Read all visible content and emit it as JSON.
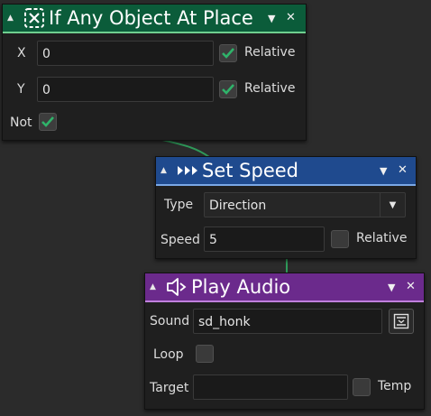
{
  "nodes": {
    "if_object": {
      "title": "If Any Object At Place",
      "x_label": "X",
      "x_value": "0",
      "x_relative_label": "Relative",
      "x_relative_checked": true,
      "y_label": "Y",
      "y_value": "0",
      "y_relative_label": "Relative",
      "y_relative_checked": true,
      "not_label": "Not",
      "not_checked": true,
      "header_color": "#0b5c3a"
    },
    "set_speed": {
      "title": "Set Speed",
      "type_label": "Type",
      "type_value": "Direction",
      "speed_label": "Speed",
      "speed_value": "5",
      "relative_label": "Relative",
      "relative_checked": false,
      "header_color": "#1f4a8e"
    },
    "play_audio": {
      "title": "Play Audio",
      "sound_label": "Sound",
      "sound_value": "sd_honk",
      "loop_label": "Loop",
      "loop_checked": false,
      "target_label": "Target",
      "target_value": "",
      "temp_label": "Temp",
      "temp_checked": false,
      "header_color": "#6b2a8c"
    }
  },
  "colors": {
    "canvas": "#2b2b2b",
    "check": "#2fb36a",
    "wire": "#2f9a5a"
  }
}
